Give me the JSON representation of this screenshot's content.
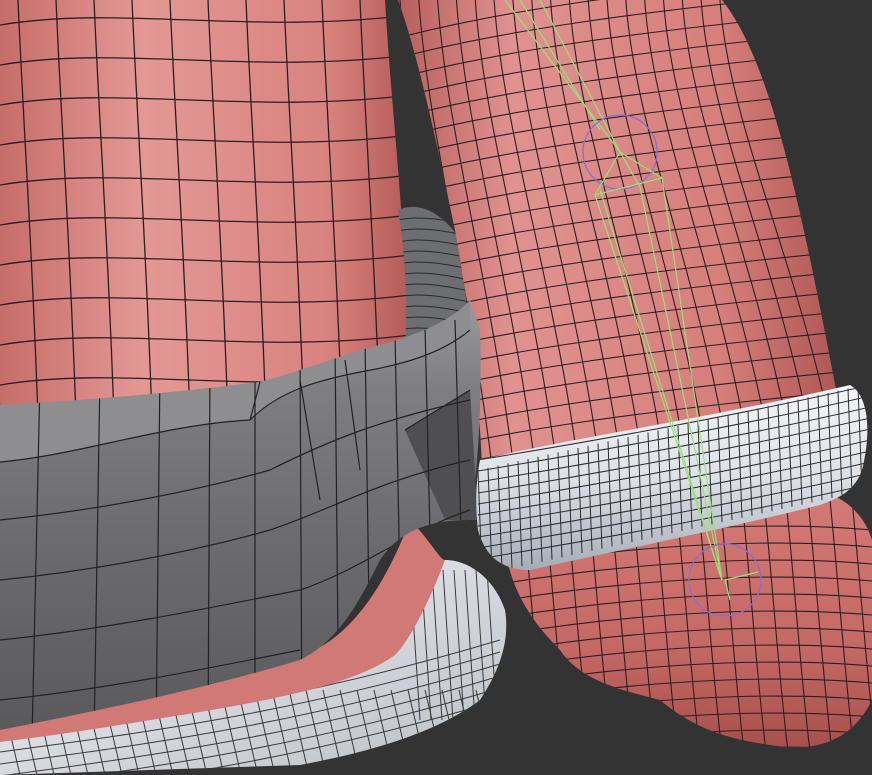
{
  "viewport": {
    "background_color": "#333333"
  },
  "palette": {
    "skin_light": "#e59a98",
    "skin_mid": "#d9827f",
    "skin_dark": "#b8605d",
    "belt_light": "#9a9a9c",
    "belt_mid": "#7e7e81",
    "belt_dark": "#5d5d60",
    "cuff_light": "#f2f4f7",
    "cuff_mid": "#d4d9e0",
    "cuff_dark": "#9ea4ad",
    "wire": "#1f1a1a",
    "bone_green": "#9be07a",
    "bone_purple": "#8a6bd6"
  },
  "objects": {
    "torso_mesh": "torso-mesh",
    "belt_mesh": "belt-mesh",
    "arm_mesh": "arm-mesh",
    "cuff_mesh": "cuff-mesh",
    "hand_mesh": "hand-mesh",
    "armature": "armature-bones"
  }
}
